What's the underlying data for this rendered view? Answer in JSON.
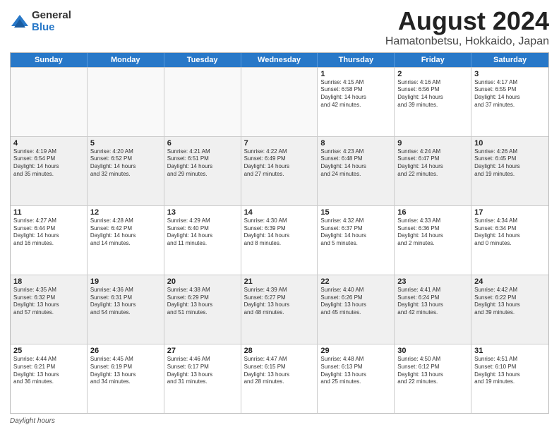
{
  "logo": {
    "general": "General",
    "blue": "Blue"
  },
  "title": "August 2024",
  "subtitle": "Hamatonbetsu, Hokkaido, Japan",
  "days": [
    "Sunday",
    "Monday",
    "Tuesday",
    "Wednesday",
    "Thursday",
    "Friday",
    "Saturday"
  ],
  "weeks": [
    [
      {
        "day": "",
        "info": ""
      },
      {
        "day": "",
        "info": ""
      },
      {
        "day": "",
        "info": ""
      },
      {
        "day": "",
        "info": ""
      },
      {
        "day": "1",
        "info": "Sunrise: 4:15 AM\nSunset: 6:58 PM\nDaylight: 14 hours\nand 42 minutes."
      },
      {
        "day": "2",
        "info": "Sunrise: 4:16 AM\nSunset: 6:56 PM\nDaylight: 14 hours\nand 39 minutes."
      },
      {
        "day": "3",
        "info": "Sunrise: 4:17 AM\nSunset: 6:55 PM\nDaylight: 14 hours\nand 37 minutes."
      }
    ],
    [
      {
        "day": "4",
        "info": "Sunrise: 4:19 AM\nSunset: 6:54 PM\nDaylight: 14 hours\nand 35 minutes."
      },
      {
        "day": "5",
        "info": "Sunrise: 4:20 AM\nSunset: 6:52 PM\nDaylight: 14 hours\nand 32 minutes."
      },
      {
        "day": "6",
        "info": "Sunrise: 4:21 AM\nSunset: 6:51 PM\nDaylight: 14 hours\nand 29 minutes."
      },
      {
        "day": "7",
        "info": "Sunrise: 4:22 AM\nSunset: 6:49 PM\nDaylight: 14 hours\nand 27 minutes."
      },
      {
        "day": "8",
        "info": "Sunrise: 4:23 AM\nSunset: 6:48 PM\nDaylight: 14 hours\nand 24 minutes."
      },
      {
        "day": "9",
        "info": "Sunrise: 4:24 AM\nSunset: 6:47 PM\nDaylight: 14 hours\nand 22 minutes."
      },
      {
        "day": "10",
        "info": "Sunrise: 4:26 AM\nSunset: 6:45 PM\nDaylight: 14 hours\nand 19 minutes."
      }
    ],
    [
      {
        "day": "11",
        "info": "Sunrise: 4:27 AM\nSunset: 6:44 PM\nDaylight: 14 hours\nand 16 minutes."
      },
      {
        "day": "12",
        "info": "Sunrise: 4:28 AM\nSunset: 6:42 PM\nDaylight: 14 hours\nand 14 minutes."
      },
      {
        "day": "13",
        "info": "Sunrise: 4:29 AM\nSunset: 6:40 PM\nDaylight: 14 hours\nand 11 minutes."
      },
      {
        "day": "14",
        "info": "Sunrise: 4:30 AM\nSunset: 6:39 PM\nDaylight: 14 hours\nand 8 minutes."
      },
      {
        "day": "15",
        "info": "Sunrise: 4:32 AM\nSunset: 6:37 PM\nDaylight: 14 hours\nand 5 minutes."
      },
      {
        "day": "16",
        "info": "Sunrise: 4:33 AM\nSunset: 6:36 PM\nDaylight: 14 hours\nand 2 minutes."
      },
      {
        "day": "17",
        "info": "Sunrise: 4:34 AM\nSunset: 6:34 PM\nDaylight: 14 hours\nand 0 minutes."
      }
    ],
    [
      {
        "day": "18",
        "info": "Sunrise: 4:35 AM\nSunset: 6:32 PM\nDaylight: 13 hours\nand 57 minutes."
      },
      {
        "day": "19",
        "info": "Sunrise: 4:36 AM\nSunset: 6:31 PM\nDaylight: 13 hours\nand 54 minutes."
      },
      {
        "day": "20",
        "info": "Sunrise: 4:38 AM\nSunset: 6:29 PM\nDaylight: 13 hours\nand 51 minutes."
      },
      {
        "day": "21",
        "info": "Sunrise: 4:39 AM\nSunset: 6:27 PM\nDaylight: 13 hours\nand 48 minutes."
      },
      {
        "day": "22",
        "info": "Sunrise: 4:40 AM\nSunset: 6:26 PM\nDaylight: 13 hours\nand 45 minutes."
      },
      {
        "day": "23",
        "info": "Sunrise: 4:41 AM\nSunset: 6:24 PM\nDaylight: 13 hours\nand 42 minutes."
      },
      {
        "day": "24",
        "info": "Sunrise: 4:42 AM\nSunset: 6:22 PM\nDaylight: 13 hours\nand 39 minutes."
      }
    ],
    [
      {
        "day": "25",
        "info": "Sunrise: 4:44 AM\nSunset: 6:21 PM\nDaylight: 13 hours\nand 36 minutes."
      },
      {
        "day": "26",
        "info": "Sunrise: 4:45 AM\nSunset: 6:19 PM\nDaylight: 13 hours\nand 34 minutes."
      },
      {
        "day": "27",
        "info": "Sunrise: 4:46 AM\nSunset: 6:17 PM\nDaylight: 13 hours\nand 31 minutes."
      },
      {
        "day": "28",
        "info": "Sunrise: 4:47 AM\nSunset: 6:15 PM\nDaylight: 13 hours\nand 28 minutes."
      },
      {
        "day": "29",
        "info": "Sunrise: 4:48 AM\nSunset: 6:13 PM\nDaylight: 13 hours\nand 25 minutes."
      },
      {
        "day": "30",
        "info": "Sunrise: 4:50 AM\nSunset: 6:12 PM\nDaylight: 13 hours\nand 22 minutes."
      },
      {
        "day": "31",
        "info": "Sunrise: 4:51 AM\nSunset: 6:10 PM\nDaylight: 13 hours\nand 19 minutes."
      }
    ]
  ],
  "footer": {
    "label": "Daylight hours"
  }
}
